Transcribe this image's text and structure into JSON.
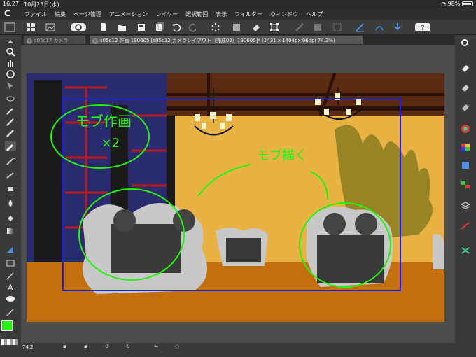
{
  "status_bar": {
    "time": "16:27",
    "date": "10月23日(水)",
    "battery": "98%"
  },
  "menu": {
    "items": [
      "ファイル",
      "編集",
      "ページ管理",
      "アニメーション",
      "レイヤー",
      "選択範囲",
      "表示",
      "フィルター",
      "ウィンドウ",
      "ヘルプ"
    ]
  },
  "tabs": [
    {
      "label": "s05c17 カメラ"
    },
    {
      "label": "s05c12 作画 190605 [s05c12 カメラレイアウト（完成02）190605]* (2431 x 1404px 96dpi 74.2%)"
    }
  ],
  "canvas": {
    "annotations": {
      "left_note_line1": "モブ作画",
      "left_note_line2": "×2",
      "center_note": "モブ描く"
    }
  },
  "bottom": {
    "zoom": "74.2"
  },
  "colors": {
    "main_color": "#21f50a",
    "sub_color": "#f4b9a2",
    "accent": "#3a3a3a"
  }
}
